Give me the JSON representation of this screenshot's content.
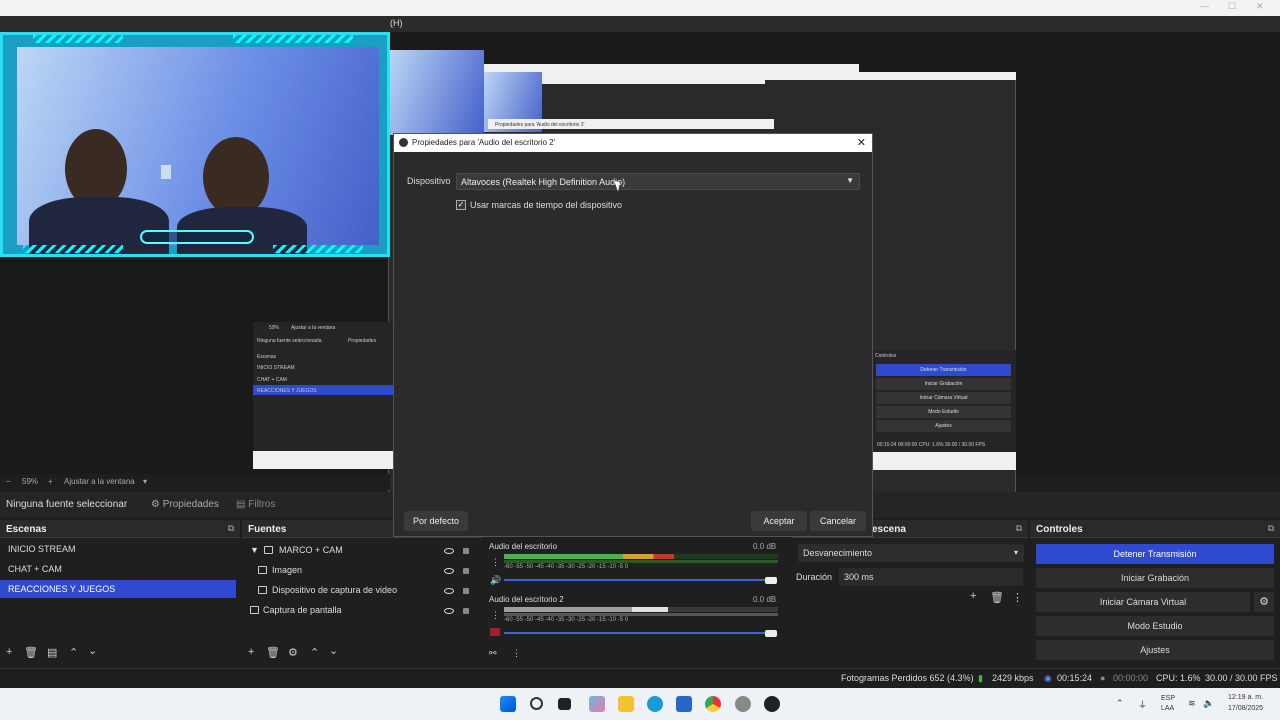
{
  "menubar": {
    "fragment": "(H)"
  },
  "mini_preview": {
    "zoom": "59%",
    "fit_label": "Ajustar a la ventana",
    "no_source": "Ninguna fuente seleccionada",
    "properties": "Propiedades",
    "scenes_title": "Escenas",
    "scenes": [
      "INICIO STREAM",
      "CHAT + CAM",
      "REACCIONES Y JUEGOS"
    ],
    "controls_title": "Controles",
    "controls": [
      "Detener Transmisión",
      "Iniciar Grabación",
      "Iniciar Cámara Virtual",
      "Modo Estudio",
      "Ajustes"
    ],
    "status": "00:15:24    00:00:00    CPU: 1.6%    30.00 / 30.00 FPS",
    "dialog_title": "Propiedades para 'Audio del escritorio 2'"
  },
  "zoom": {
    "percent": "59%",
    "fit_label": "Ajustar a la ventana"
  },
  "source_bar": {
    "no_source": "Ninguna fuente seleccionar",
    "properties": "Propiedades",
    "filters": "Filtros"
  },
  "scenes": {
    "title": "Escenas",
    "items": [
      "INICIO STREAM",
      "CHAT + CAM",
      "REACCIONES Y JUEGOS"
    ]
  },
  "sources": {
    "title": "Fuentes",
    "items": [
      "MARCO + CAM",
      "Imagen",
      "Dispositivo de captura de video",
      "Captura de pantalla"
    ]
  },
  "mixer": {
    "channels": [
      {
        "name": "Audio del escritorio",
        "db": "0.0 dB",
        "level": 0.62
      },
      {
        "name": "Audio del escritorio 2",
        "db": "0.0 dB",
        "level": 0.6
      }
    ],
    "ticks": "-60  -55  -50  -45  -40  -35  -30  -25  -20  -15  -10   -5    0"
  },
  "transitions": {
    "title": "escena",
    "type": "Desvanecimiento",
    "duration_label": "Duración",
    "duration_value": "300 ms"
  },
  "controls": {
    "title": "Controles",
    "buttons": [
      "Detener Transmisión",
      "Iniciar Grabación",
      "Iniciar Cámara Virtual",
      "Modo Estudio",
      "Ajustes"
    ]
  },
  "status": {
    "dropped": "Fotogramas Perdidos 652 (4.3%)",
    "bitrate": "2429 kbps",
    "live_time": "00:15:24",
    "rec_time": "00:00:00",
    "cpu": "CPU: 1.6%",
    "fps": "30.00 / 30.00 FPS"
  },
  "taskbar": {
    "lang": "ESP",
    "lang2": "LAA",
    "time": "12:19 a. m.",
    "date": "17/08/2025"
  },
  "dialog": {
    "title": "Propiedades para 'Audio del escritorio 2'",
    "device_label": "Dispositivo",
    "device_value": "Altavoces (Realtek High Definition Audio)",
    "checkbox_label": "Usar marcas de tiempo del dispositivo",
    "checkbox_checked": true,
    "default_button": "Por defecto",
    "accept_button": "Aceptar",
    "cancel_button": "Cancelar"
  },
  "colors": {
    "accent": "#2f4ad0",
    "cyan_frame": "#27e0f0"
  }
}
